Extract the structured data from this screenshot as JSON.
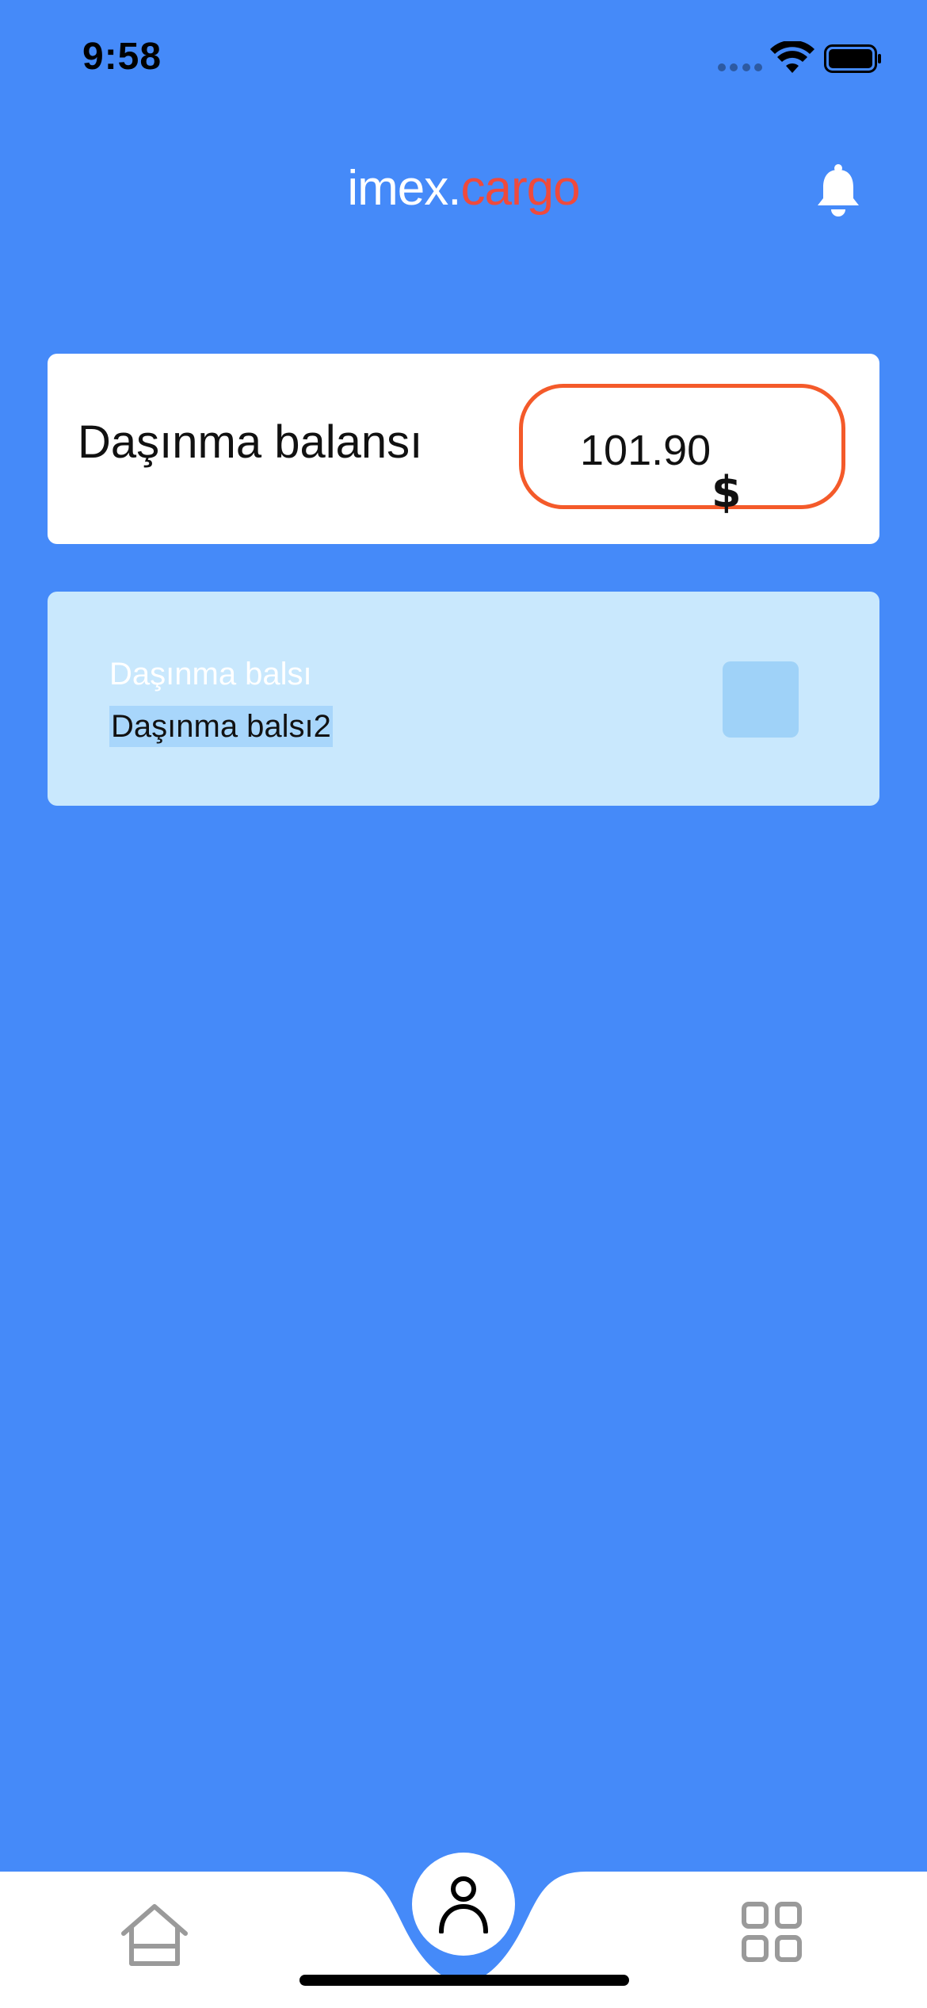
{
  "status_bar": {
    "time": "9:58"
  },
  "header": {
    "logo_part1": "imex.",
    "logo_part2": "cargo",
    "notification_icon": "bell-icon"
  },
  "balance": {
    "label": "Daşınma balansı",
    "value": "101.90",
    "currency": "$"
  },
  "info_card": {
    "title": "Daşınma balsı",
    "subtitle": "Daşınma balsı2"
  },
  "bottom_nav": {
    "items": [
      {
        "icon": "home-icon"
      },
      {
        "icon": "profile-icon",
        "active": true
      },
      {
        "icon": "grid-icon"
      }
    ]
  },
  "colors": {
    "background": "#458af9",
    "logo_accent": "#ef4a3c",
    "balance_border": "#f45a2a",
    "info_card": "#c9e8fd"
  }
}
